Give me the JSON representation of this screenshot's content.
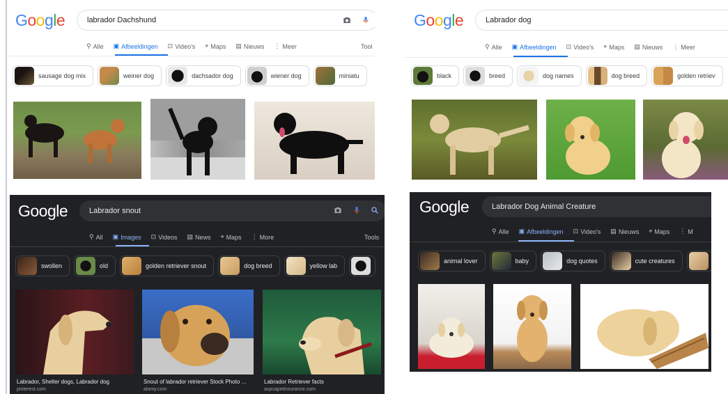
{
  "colors": {
    "google_blue": "#4285F4",
    "google_red": "#EA4335",
    "google_yellow": "#FBBC05",
    "google_green": "#34A853",
    "active_tab_light": "#1a73e8",
    "active_tab_dark": "#8ab4f8",
    "dark_bg": "#202124"
  },
  "panel_tl": {
    "logo": "Google",
    "search_query": "labrador Dachshund",
    "tabs": [
      "Alle",
      "Afbeeldingen",
      "Video's",
      "Maps",
      "Nieuws",
      "Meer"
    ],
    "active_tab": "Afbeeldingen",
    "tools": "Tool",
    "chips": [
      "sausage dog mix",
      "weiner dog",
      "dachsador dog",
      "wiener dog",
      "miniatu"
    ]
  },
  "panel_tr": {
    "logo": "Google",
    "search_query": "Labrador dog",
    "tabs": [
      "Alle",
      "Afbeeldingen",
      "Video's",
      "Maps",
      "Nieuws",
      "Meer"
    ],
    "active_tab": "Afbeeldingen",
    "chips": [
      "black",
      "breed",
      "dog names",
      "dog breed",
      "golden retriev"
    ]
  },
  "panel_bl": {
    "logo": "Google",
    "search_query": "Labrador snout",
    "tabs": [
      "All",
      "Images",
      "Videos",
      "News",
      "Maps",
      "More"
    ],
    "active_tab": "Images",
    "tools": "Tools",
    "chips": [
      "swollen",
      "old",
      "golden retriever snout",
      "dog breed",
      "yellow lab"
    ],
    "results": [
      {
        "title": "Labrador, Shelter dogs, Labrador dog",
        "source": "pinterest.com"
      },
      {
        "title": "Snout of labrador retriever Stock Photo ...",
        "source": "alamy.com"
      },
      {
        "title": "Labrador Retriever facts",
        "source": "aspcapetinsurance.com"
      }
    ]
  },
  "panel_br": {
    "logo": "Google",
    "search_query": "Labrador Dog Animal Creature",
    "tabs": [
      "Alle",
      "Afbeeldingen",
      "Video's",
      "Nieuws",
      "Maps",
      "M"
    ],
    "active_tab": "Afbeeldingen",
    "chips": [
      "animal lover",
      "baby",
      "dog quotes",
      "cute creatures"
    ]
  }
}
